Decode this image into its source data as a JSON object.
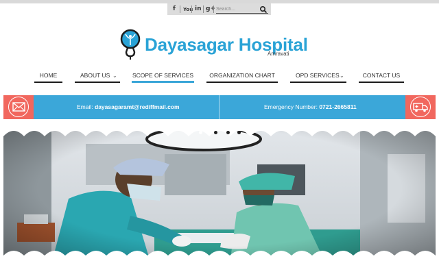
{
  "topbar": {
    "social": [
      {
        "name": "facebook-icon",
        "glyph": "f"
      },
      {
        "name": "youtube-icon",
        "glyph": "You"
      },
      {
        "name": "linkedin-icon",
        "glyph": "in"
      },
      {
        "name": "googleplus-icon",
        "glyph": "g+"
      }
    ],
    "search": {
      "placeholder": "Search...",
      "icon": "search-icon"
    }
  },
  "logo": {
    "title": "Dayasagar Hospital",
    "subtitle": "Amravati",
    "icon": "stethoscope-logo-icon",
    "color": "#2aa3d6"
  },
  "nav": [
    {
      "label": "HOME",
      "active": false,
      "dropdown": false
    },
    {
      "label": "ABOUT US",
      "active": false,
      "dropdown": true
    },
    {
      "label": "SCOPE OF SERVICES",
      "active": true,
      "dropdown": false
    },
    {
      "label": "ORGANIZATION CHART",
      "active": false,
      "dropdown": false
    },
    {
      "label": "OPD SERVICES",
      "active": false,
      "dropdown": true
    },
    {
      "label": "CONTACT US",
      "active": false,
      "dropdown": false
    }
  ],
  "contact_bar": {
    "email_label": "Email:",
    "email": "dayasagaramt@rediffmail.com",
    "emergency_label": "Emergency Number:",
    "emergency": "0721-2665811",
    "email_icon": "envelope-icon",
    "emergency_icon": "ambulance-icon",
    "bar_color": "#3ba7d9",
    "icon_bg": "#f1675e"
  },
  "hero": {
    "scene": "surgeons-operating-room-photo",
    "active_slide": 1,
    "slide_count": 4
  }
}
